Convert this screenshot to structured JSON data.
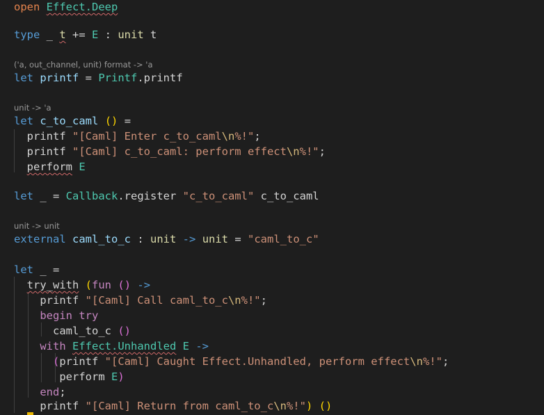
{
  "editor": {
    "language": "OCaml",
    "colors": {
      "background": "#1e1e1e",
      "keyword": "#569cd6",
      "control_keyword": "#c586c0",
      "string": "#ce9178",
      "module": "#4ec9b0",
      "cursor": "#e8b500"
    },
    "lines": [
      {
        "kind": "code",
        "segments": [
          [
            "kw-open",
            "open"
          ],
          [
            "op",
            " "
          ],
          [
            "mod sq",
            "Effect.Deep"
          ]
        ]
      },
      {
        "kind": "code",
        "segments": [
          [
            "kw",
            "type"
          ],
          [
            "op",
            " _ "
          ],
          [
            "unitt sq",
            "t"
          ],
          [
            "op",
            " += "
          ],
          [
            "mod",
            "E"
          ],
          [
            "op",
            " : "
          ],
          [
            "unitt",
            "unit"
          ],
          [
            "op",
            " t"
          ]
        ]
      },
      {
        "kind": "hint",
        "segments": [
          [
            "hint",
            "('a, out_channel, unit) format -> 'a"
          ]
        ]
      },
      {
        "kind": "code",
        "segments": [
          [
            "kw",
            "let"
          ],
          [
            "op",
            " "
          ],
          [
            "ident",
            "printf"
          ],
          [
            "op",
            " = "
          ],
          [
            "mod",
            "Printf"
          ],
          [
            "op",
            ".printf"
          ]
        ]
      },
      {
        "kind": "hint",
        "segments": [
          [
            "hint",
            "unit -> 'a"
          ]
        ]
      },
      {
        "kind": "code",
        "segments": [
          [
            "kw",
            "let"
          ],
          [
            "op",
            " "
          ],
          [
            "ident",
            "c_to_caml"
          ],
          [
            "op",
            " "
          ],
          [
            "p1",
            "()"
          ],
          [
            "op",
            " ="
          ]
        ]
      },
      {
        "kind": "code",
        "segments": [
          [
            "op",
            "  printf "
          ],
          [
            "str",
            "\"[Caml] Enter c_to_caml"
          ],
          [
            "esc",
            "\\n"
          ],
          [
            "str",
            "%!\""
          ],
          [
            "op",
            ";"
          ]
        ]
      },
      {
        "kind": "code",
        "segments": [
          [
            "op",
            "  printf "
          ],
          [
            "str",
            "\"[Caml] c_to_caml: perform effect"
          ],
          [
            "esc",
            "\\n"
          ],
          [
            "str",
            "%!\""
          ],
          [
            "op",
            ";"
          ]
        ]
      },
      {
        "kind": "code",
        "segments": [
          [
            "op",
            "  "
          ],
          [
            "op sq",
            "perform"
          ],
          [
            "op",
            " "
          ],
          [
            "mod",
            "E"
          ]
        ]
      },
      {
        "kind": "code",
        "segments": [
          [
            "kw",
            "let"
          ],
          [
            "op",
            " _ = "
          ],
          [
            "mod",
            "Callback"
          ],
          [
            "op",
            ".register "
          ],
          [
            "str",
            "\"c_to_caml\""
          ],
          [
            "op",
            " c_to_caml"
          ]
        ]
      },
      {
        "kind": "hint",
        "segments": [
          [
            "hint",
            "unit -> unit"
          ]
        ]
      },
      {
        "kind": "code",
        "segments": [
          [
            "kw",
            "external"
          ],
          [
            "op",
            " "
          ],
          [
            "ident",
            "caml_to_c"
          ],
          [
            "op",
            " : "
          ],
          [
            "unitt",
            "unit"
          ],
          [
            "op",
            " "
          ],
          [
            "kw",
            "->"
          ],
          [
            "op",
            " "
          ],
          [
            "unitt",
            "unit"
          ],
          [
            "op",
            " = "
          ],
          [
            "str",
            "\"caml_to_c\""
          ]
        ]
      },
      {
        "kind": "code",
        "segments": [
          [
            "kw",
            "let"
          ],
          [
            "op",
            " _ ="
          ]
        ]
      },
      {
        "kind": "code",
        "segments": [
          [
            "op",
            "  "
          ],
          [
            "op sq",
            "try_with"
          ],
          [
            "op",
            " "
          ],
          [
            "p1",
            "("
          ],
          [
            "kw-c",
            "fun"
          ],
          [
            "op",
            " "
          ],
          [
            "p2",
            "()"
          ],
          [
            "op",
            " "
          ],
          [
            "kw",
            "->"
          ]
        ]
      },
      {
        "kind": "code",
        "segments": [
          [
            "op",
            "    printf "
          ],
          [
            "str",
            "\"[Caml] Call caml_to_c"
          ],
          [
            "esc",
            "\\n"
          ],
          [
            "str",
            "%!\""
          ],
          [
            "op",
            ";"
          ]
        ]
      },
      {
        "kind": "code",
        "segments": [
          [
            "op",
            "    "
          ],
          [
            "kw-c",
            "begin"
          ],
          [
            "op",
            " "
          ],
          [
            "kw-c",
            "try"
          ]
        ]
      },
      {
        "kind": "code",
        "segments": [
          [
            "op",
            "      caml_to_c "
          ],
          [
            "p2",
            "()"
          ]
        ]
      },
      {
        "kind": "code",
        "segments": [
          [
            "op",
            "    "
          ],
          [
            "kw-c",
            "with"
          ],
          [
            "op",
            " "
          ],
          [
            "mod sq",
            "Effect.Unhandled"
          ],
          [
            "op",
            " "
          ],
          [
            "mod",
            "E"
          ],
          [
            "op",
            " "
          ],
          [
            "kw",
            "->"
          ]
        ]
      },
      {
        "kind": "code",
        "segments": [
          [
            "op",
            "      "
          ],
          [
            "p2",
            "("
          ],
          [
            "op",
            "printf "
          ],
          [
            "str",
            "\"[Caml] Caught Effect.Unhandled, perform effect"
          ],
          [
            "esc",
            "\\n"
          ],
          [
            "str",
            "%!\""
          ],
          [
            "op",
            ";"
          ]
        ]
      },
      {
        "kind": "code",
        "segments": [
          [
            "op",
            "       perform "
          ],
          [
            "mod",
            "E"
          ],
          [
            "p2",
            ")"
          ]
        ]
      },
      {
        "kind": "code",
        "segments": [
          [
            "op",
            "    "
          ],
          [
            "kw-c",
            "end"
          ],
          [
            "op",
            ";"
          ]
        ]
      },
      {
        "kind": "code",
        "segments": [
          [
            "op",
            "    printf "
          ],
          [
            "str",
            "\"[Caml] Return from caml_to_c"
          ],
          [
            "esc",
            "\\n"
          ],
          [
            "str",
            "%!\""
          ],
          [
            "p1",
            ")"
          ],
          [
            "op",
            " "
          ],
          [
            "p1",
            "()"
          ]
        ]
      }
    ]
  }
}
